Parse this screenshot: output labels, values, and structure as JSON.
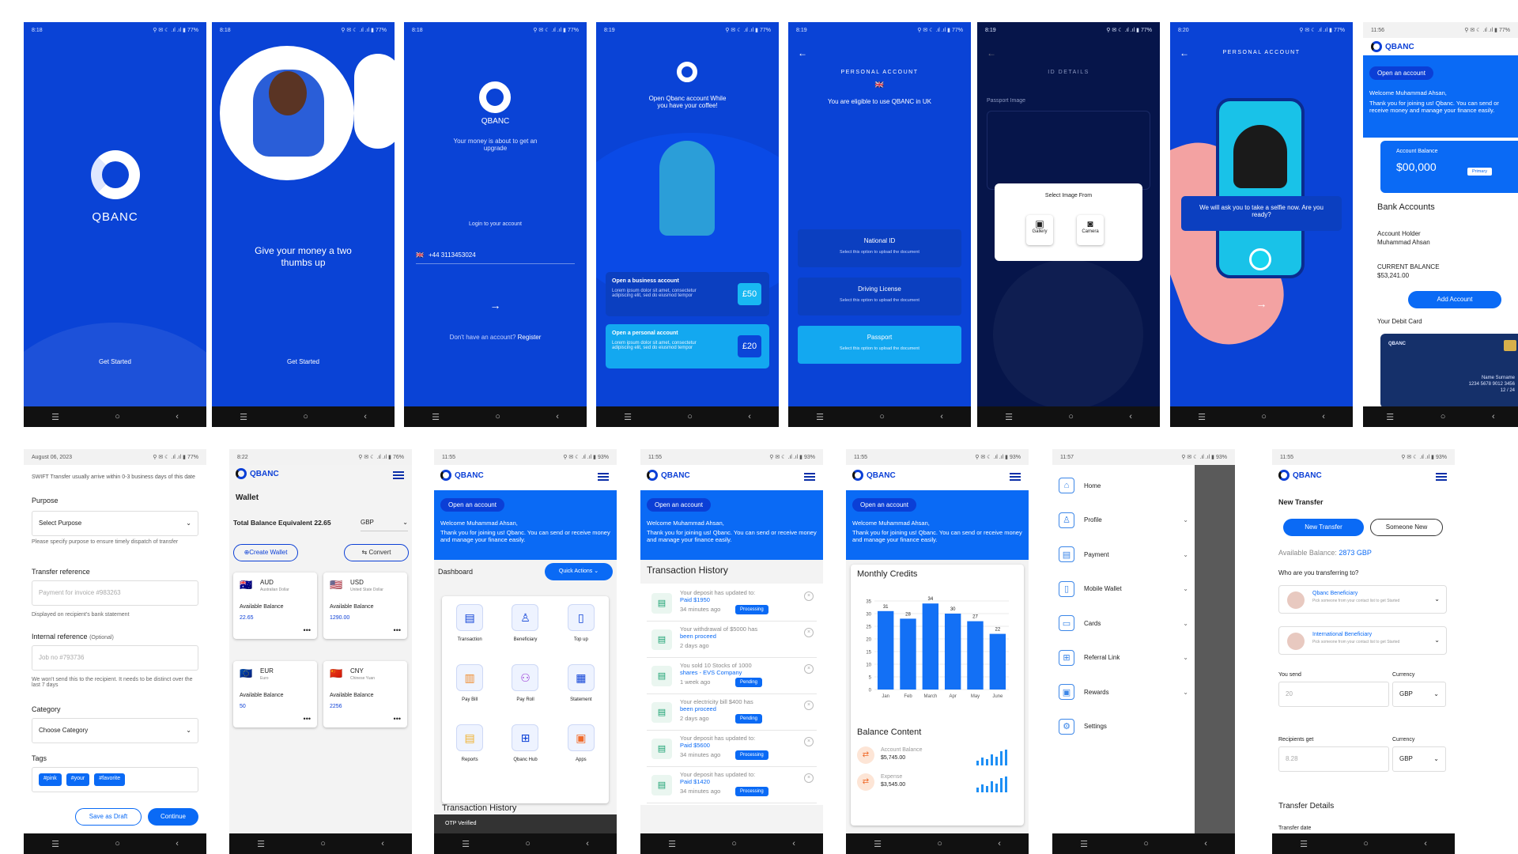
{
  "status": {
    "time_a": "8:18",
    "time_b": "8:19",
    "time_c": "8:20",
    "time_d": "11:56",
    "time_e": "8:22",
    "time_f": "11:55",
    "time_g": "11:57",
    "right": "⚲ ✉ ☾ .ıl .ıl ▮ 77%",
    "right_b": "⚲ ✉ ☾ .ıl .ıl ▮ 76%",
    "right_c": "⚲ ✉ ☾ .ıl .ıl ▮ 93%"
  },
  "nav": {
    "menu": "☰",
    "home": "○",
    "back": "‹"
  },
  "brand": {
    "name": "QBANC",
    "accent": "#0a43d6",
    "light": "#0a6af5"
  },
  "s1": {
    "get_started": "Get Started"
  },
  "s2": {
    "tagline": "Give your money a two thumbs up",
    "get_started": "Get Started"
  },
  "s3": {
    "tagline": "Your money is about to get an upgrade",
    "login": "Login to your account",
    "flag": "🇬🇧",
    "phone": "+44  3113453024",
    "no_account": "Don't have an account?",
    "register": "Register",
    "arrow": "→"
  },
  "s4": {
    "title": "Open Qbanc account While you have your coffee!",
    "biz_title": "Open a business account",
    "biz_text": "Lorem ipsum dolor sit amet, consectetur adipiscing elit, sed do eiusmod tempor",
    "biz_price": "£50",
    "per_title": "Open a personal account",
    "per_text": "Lorem ipsum dolor sit amet, consectetur adipiscing elit, sed do eiusmod tempor",
    "per_price": "£20"
  },
  "s5": {
    "heading": "PERSONAL ACCOUNT",
    "flag": "🇬🇧",
    "eligible": "You are eligible to use QBANC in UK",
    "opt1": "National ID",
    "opt2": "Driving License",
    "opt3": "Passport",
    "opt_sub": "Select this option to upload the document"
  },
  "s6": {
    "heading": "ID DETAILS",
    "passport": "Passport Image",
    "dialog": "Select Image From",
    "gallery": "Gallery",
    "camera": "Camera"
  },
  "s7": {
    "heading": "PERSONAL ACCOUNT",
    "prompt": "We will ask you to take a selfie now. Are you ready?",
    "arrow": "→"
  },
  "s8": {
    "open": "Open an account",
    "welcome": "Welcome Muhammad Ahsan,",
    "intro": "Thank you for joining us! Qbanc. You can send or receive money and manage your finance easily.",
    "bal_label": "Account Balance",
    "bal": "$00,000",
    "primary": "Primary",
    "bank_accounts": "Bank Accounts",
    "holder_label": "Account Holder",
    "holder": "Muhammad Ahsan",
    "cur_label": "CURRENT BALANCE",
    "cur": "$53,241.00",
    "add": "Add Account",
    "debit": "Your Debit Card",
    "card_name": "Name Surname",
    "card_no": "1234 5678 9012 3456",
    "card_exp": "12 / 24"
  },
  "s9": {
    "date": "August 06, 2023",
    "swift": "SWIFT Transfer usually arrive within 0-3 business days of this date",
    "purpose": "Purpose",
    "purpose_val": "Select Purpose",
    "purpose_help": "Please specify purpose to ensure timely dispatch of transfer",
    "ref": "Transfer reference",
    "ref_ph": "Payment for invoice #983263",
    "ref_help": "Displayed on recipient's bank statement",
    "internal": "Internal reference",
    "optional": "(Optional)",
    "internal_ph": "Job no #793736",
    "internal_help": "We won't send this to the recipient. It needs to be distinct over the last 7 days",
    "category": "Category",
    "category_val": "Choose Category",
    "tags": "Tags",
    "tag1": "#pink",
    "tag2": "#your",
    "tag3": "#favorite",
    "draft": "Save as Draft",
    "continue": "Continue"
  },
  "s10": {
    "title": "Wallet",
    "total_label": "Total Balance Equivalent",
    "total": "22.65",
    "cur": "GBP",
    "create": "Create Wallet",
    "convert": "Convert",
    "avail": "Available Balance",
    "w": [
      {
        "code": "AUD",
        "name": "Australian Dollar",
        "bal": "22.65",
        "flag": "🇦🇺"
      },
      {
        "code": "USD",
        "name": "United State Dollar",
        "bal": "1290.00",
        "flag": "🇺🇸"
      },
      {
        "code": "EUR",
        "name": "Euro",
        "bal": "50",
        "flag": "🇪🇺"
      },
      {
        "code": "CNY",
        "name": "Chinese Yuan",
        "bal": "2256",
        "flag": "🇨🇳"
      }
    ]
  },
  "s11": {
    "open": "Open an account",
    "welcome": "Welcome Muhammad Ahsan,",
    "intro": "Thank you for joining us! Qbanc. You can send or receive money and manage your finance easily.",
    "dashboard": "Dashboard",
    "quick": "Quick Actions",
    "items": [
      "Transaction",
      "Beneficiary",
      "Top up",
      "Pay Bill",
      "Pay Roll",
      "Statement",
      "Reports",
      "Qbanc Hub",
      "Apps"
    ],
    "history": "Transaction History",
    "toast": "OTP Verified"
  },
  "s12": {
    "open": "Open an account",
    "welcome": "Welcome Muhammad Ahsan,",
    "intro": "Thank you for joining us! Qbanc. You can send or receive money and manage your finance easily.",
    "title": "Transaction History",
    "tx": [
      {
        "l1": "Your deposit has updated to:",
        "l2": "Paid $1950",
        "t": "34 minutes ago",
        "b": "Processing"
      },
      {
        "l1": "Your withdrawal of $5000 has",
        "l2": "been proceed",
        "t": "2 days ago",
        "b": ""
      },
      {
        "l1": "You sold 10 Stocks of 1000",
        "l2": "shares - EVS Company",
        "t": "1 week ago",
        "b": "Pending"
      },
      {
        "l1": "Your electricity bill $400 has",
        "l2": "been proceed",
        "t": "2 days ago",
        "b": "Pending"
      },
      {
        "l1": "Your deposit has updated to:",
        "l2": "Paid $5600",
        "t": "34 minutes ago",
        "b": "Processing"
      },
      {
        "l1": "Your deposit has updated to:",
        "l2": "Paid $1420",
        "t": "34 minutes ago",
        "b": "Processing"
      }
    ]
  },
  "s13": {
    "open": "Open an account",
    "welcome": "Welcome Muhammad Ahsan,",
    "intro": "Thank you for joining us! Qbanc. You can send or receive money and manage your finance easily.",
    "monthly": "Monthly Credits",
    "balance_content": "Balance Content",
    "acct_label": "Account Balance",
    "acct": "$5,745.00",
    "exp_label": "Expense",
    "exp": "$3,545.00"
  },
  "chart_data": {
    "type": "bar",
    "title": "Monthly Credits",
    "categories": [
      "Jan",
      "Feb",
      "March",
      "Apr",
      "May",
      "June"
    ],
    "values": [
      31,
      28,
      34,
      30,
      27,
      22
    ],
    "ylim": [
      0,
      35
    ],
    "yticks": [
      0,
      5,
      10,
      15,
      20,
      25,
      30,
      35
    ]
  },
  "s14": {
    "items": [
      "Home",
      "Profile",
      "Payment",
      "Mobile Wallet",
      "Cards",
      "Referral Link",
      "Rewards",
      "Settings"
    ]
  },
  "s15": {
    "title": "New Transfer",
    "tab1": "New Transfer",
    "tab2": "Someone New",
    "avail_label": "Available Balance:",
    "avail": "2873 GBP",
    "who": "Who are you transferring to?",
    "b1": "Qbanc Beneficiary",
    "b2": "International Beneficiary",
    "bsub": "Pick someone from your contact list to get Started",
    "send": "You send",
    "currency": "Currency",
    "send_val": "20",
    "cur": "GBP",
    "recv": "Recipients get",
    "recv_val": "8.28",
    "details": "Transfer Details",
    "tdate": "Transfer date"
  }
}
